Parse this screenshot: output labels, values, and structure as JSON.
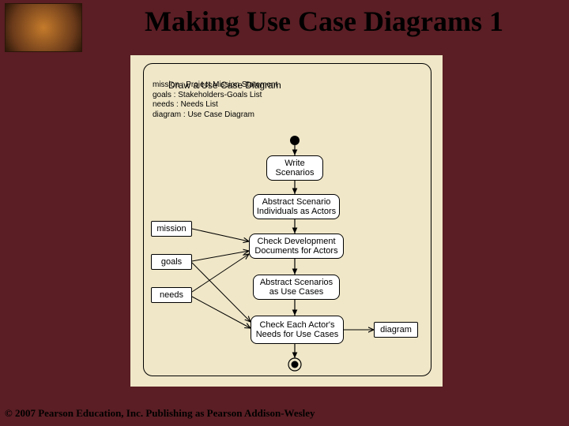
{
  "title": "Making Use Case Diagrams 1",
  "copyright": "© 2007 Pearson Education, Inc. Publishing as Pearson Addison-Wesley",
  "diagram": {
    "frameTitle": "Draw a Use Case Diagram",
    "frameLines": "mission : Project Mission Statement\ngoals : Stakeholders-Goals List\nneeds : Needs List\ndiagram : Use Case Diagram",
    "activities": {
      "write": "Write\nScenarios",
      "abstractActors": "Abstract Scenario\nIndividuals as Actors",
      "checkDocs": "Check Development\nDocuments for Actors",
      "abstractUse": "Abstract Scenarios\nas Use Cases",
      "checkActor": "Check Each Actor's\nNeeds for Use Cases"
    },
    "objects": {
      "mission": "mission",
      "goals": "goals",
      "needs": "needs",
      "diagram": "diagram"
    }
  }
}
